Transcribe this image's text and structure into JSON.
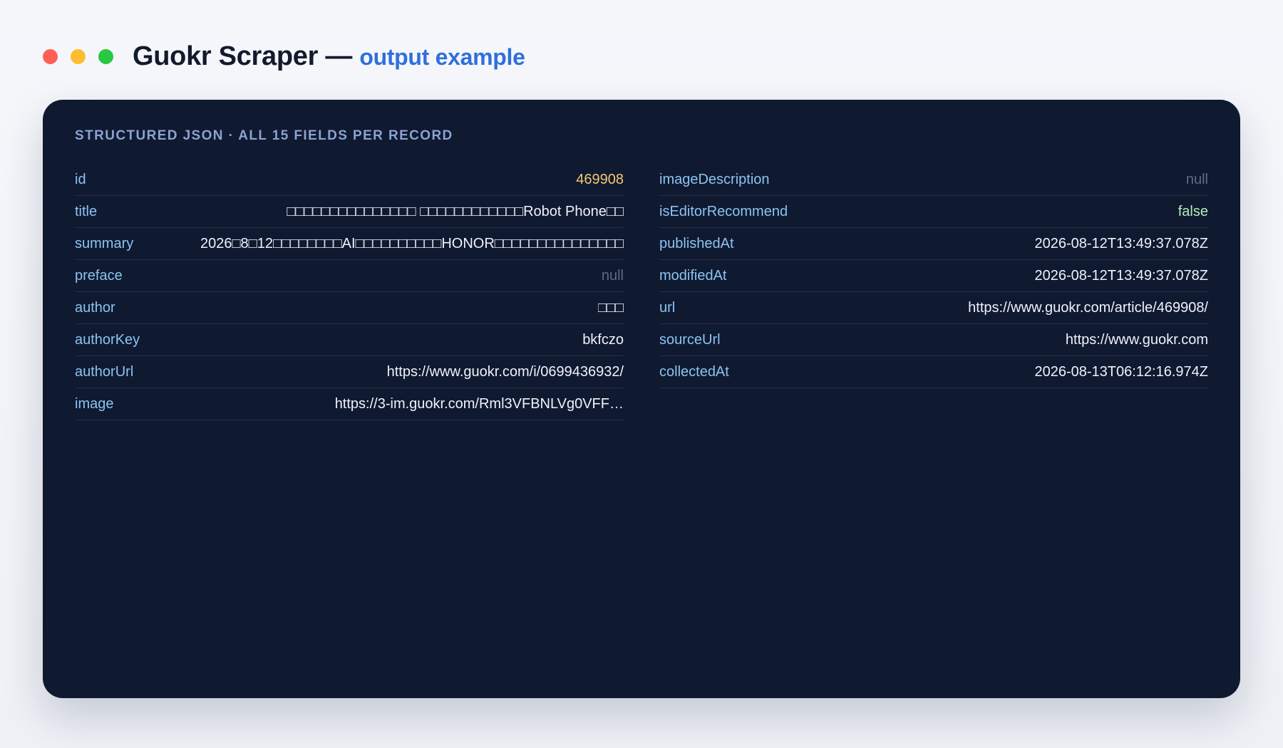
{
  "window": {
    "controls": [
      {
        "name": "close",
        "color": "#ff5f57"
      },
      {
        "name": "minimize",
        "color": "#febc2e"
      },
      {
        "name": "maximize",
        "color": "#28c840"
      }
    ],
    "title": "Guokr Scraper —",
    "subtitle": "output example"
  },
  "panel": {
    "caption": "STRUCTURED JSON · ALL 15 FIELDS PER RECORD",
    "left": [
      {
        "key": "id",
        "value": "469908",
        "type": "num"
      },
      {
        "key": "title",
        "value": "□□□□□□□□□□□□□□□ □□□□□□□□□□□□Robot Phone□□",
        "type": "str"
      },
      {
        "key": "summary",
        "value": "2026□8□12□□□□□□□□AI□□□□□□□□□□HONOR□□□□□□□□□□□□□□□",
        "type": "str"
      },
      {
        "key": "preface",
        "value": "null",
        "type": "null"
      },
      {
        "key": "author",
        "value": "□□□",
        "type": "str"
      },
      {
        "key": "authorKey",
        "value": "bkfczo",
        "type": "str"
      },
      {
        "key": "authorUrl",
        "value": "https://www.guokr.com/i/0699436932/",
        "type": "str"
      },
      {
        "key": "image",
        "value": "https://3-im.guokr.com/Rml3VFBNLVg0VFF…",
        "type": "str"
      }
    ],
    "right": [
      {
        "key": "imageDescription",
        "value": "null",
        "type": "null"
      },
      {
        "key": "isEditorRecommend",
        "value": "false",
        "type": "bool"
      },
      {
        "key": "publishedAt",
        "value": "2026-08-12T13:49:37.078Z",
        "type": "str"
      },
      {
        "key": "modifiedAt",
        "value": "2026-08-12T13:49:37.078Z",
        "type": "str"
      },
      {
        "key": "url",
        "value": "https://www.guokr.com/article/469908/",
        "type": "str"
      },
      {
        "key": "sourceUrl",
        "value": "https://www.guokr.com",
        "type": "str"
      },
      {
        "key": "collectedAt",
        "value": "2026-08-13T06:12:16.974Z",
        "type": "str"
      }
    ]
  }
}
